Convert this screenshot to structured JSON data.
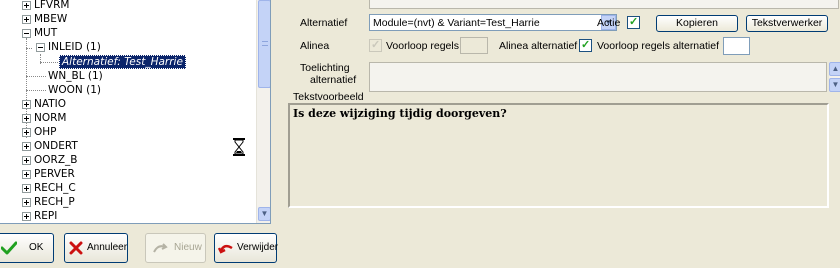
{
  "tree": {
    "items": [
      {
        "label": "LFVRM",
        "expander": "plus"
      },
      {
        "label": "MBEW",
        "expander": "plus"
      },
      {
        "label": "MUT",
        "expander": "minus"
      },
      {
        "label": "INLEID (1)",
        "expander": "minus"
      },
      {
        "label": "Alternatief: Test_Harrie",
        "selected": true
      },
      {
        "label": "WN_BL (1)"
      },
      {
        "label": "WOON (1)"
      },
      {
        "label": "NATIO",
        "expander": "plus"
      },
      {
        "label": "NORM",
        "expander": "plus"
      },
      {
        "label": "OHP",
        "expander": "plus"
      },
      {
        "label": "ONDERT",
        "expander": "plus"
      },
      {
        "label": "OORZ_B",
        "expander": "plus"
      },
      {
        "label": "PERVER",
        "expander": "plus"
      },
      {
        "label": "RECH_C",
        "expander": "plus"
      },
      {
        "label": "RECH_P",
        "expander": "plus"
      },
      {
        "label": "REPI",
        "expander": "plus"
      }
    ],
    "cursor_icon": "hourglass-icon"
  },
  "detail": {
    "alternatief_label": "Alternatief",
    "alternatief_value": "Module=(nvt) & Variant=Test_Harrie",
    "actie_label": "Actie",
    "actie_checked": true,
    "kopieren_label": "Kopieren",
    "tekstverwerker_label": "Tekstverwerker",
    "alinea_label": "Alinea",
    "voorloop_regels_label": "Voorloop regels",
    "voorloop_regels_checked": true,
    "alinea_alternatief_label": "Alinea alternatief",
    "voorloop_regels_alternatief_label": "Voorloop regels alternatief",
    "voorloop_regels_alternatief_checked": true,
    "toelichting_label_line1": "Toelichting",
    "toelichting_label_line2": "alternatief",
    "tekstvoorbeeld_label": "Tekstvoorbeeld",
    "preview_text": "Is deze wijziging tijdig doorgeven?"
  },
  "buttons": {
    "ok": "OK",
    "annuleer": "Annuleer",
    "nieuw": "Nieuw",
    "verwijder": "Verwijder"
  },
  "colors": {
    "selection": "#0a246a",
    "check_green": "#21a121",
    "cancel_red": "#cc1111",
    "window_bg": "#ece9d8"
  }
}
